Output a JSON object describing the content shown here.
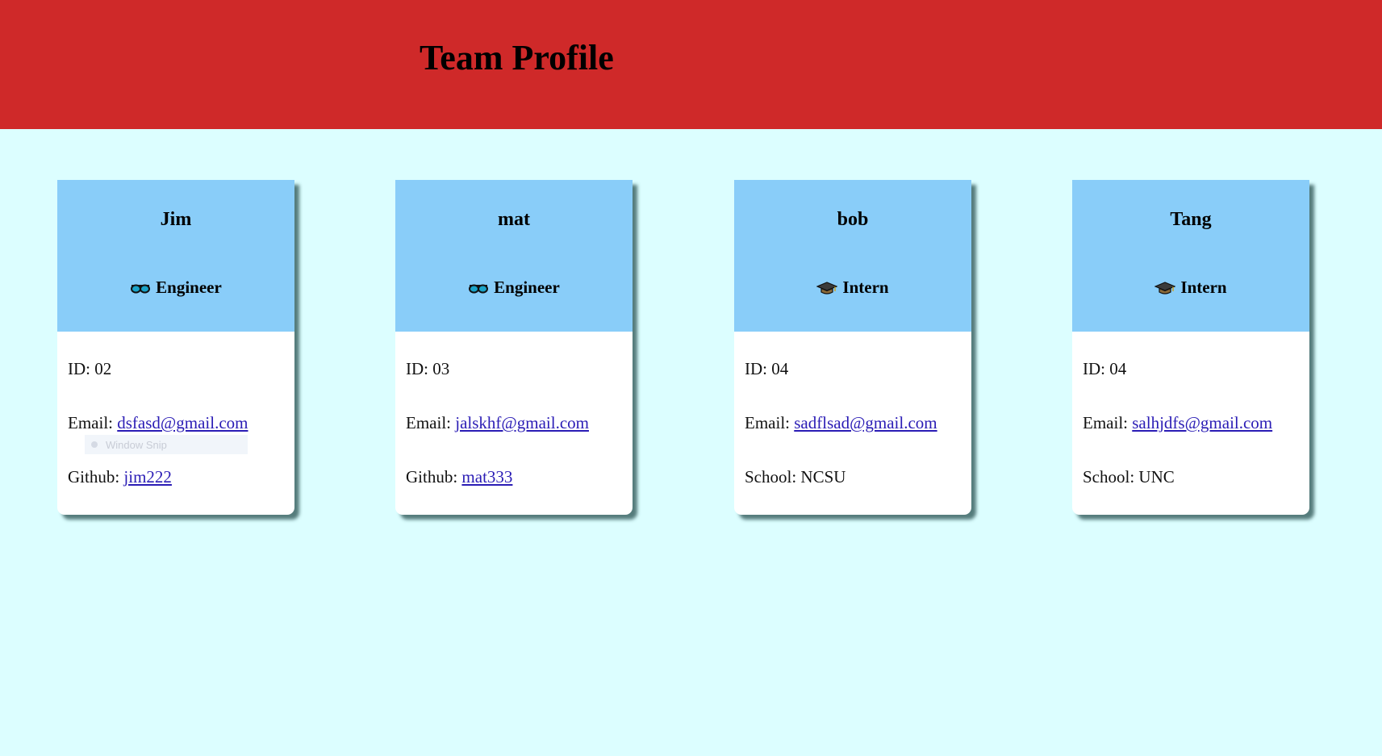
{
  "header": {
    "title": "Team Profile",
    "background": "#cf2929"
  },
  "page": {
    "background": "#dcfeff"
  },
  "overlay": {
    "label": "Window Snip"
  },
  "cards": [
    {
      "name": "Jim",
      "role": "Engineer",
      "icon": "glasses-icon",
      "id_label": "ID: ",
      "id": "02",
      "email_label": "Email: ",
      "email": "dsfasd@gmail.com",
      "extra_label": "Github: ",
      "extra_value": "jim222",
      "extra_is_link": true
    },
    {
      "name": "mat",
      "role": "Engineer",
      "icon": "glasses-icon",
      "id_label": "ID: ",
      "id": "03",
      "email_label": "Email: ",
      "email": "jalskhf@gmail.com",
      "extra_label": "Github: ",
      "extra_value": "mat333",
      "extra_is_link": true
    },
    {
      "name": "bob",
      "role": "Intern",
      "icon": "graduation-cap-icon",
      "id_label": "ID: ",
      "id": "04",
      "email_label": "Email: ",
      "email": "sadflsad@gmail.com",
      "extra_label": "School: ",
      "extra_value": "NCSU",
      "extra_is_link": false
    },
    {
      "name": "Tang",
      "role": "Intern",
      "icon": "graduation-cap-icon",
      "id_label": "ID: ",
      "id": "04",
      "email_label": "Email: ",
      "email": "salhjdfs@gmail.com",
      "extra_label": "School: ",
      "extra_value": "UNC",
      "extra_is_link": false
    }
  ],
  "colors": {
    "card_header": "#89cdf9",
    "link": "#2a1cb5"
  }
}
